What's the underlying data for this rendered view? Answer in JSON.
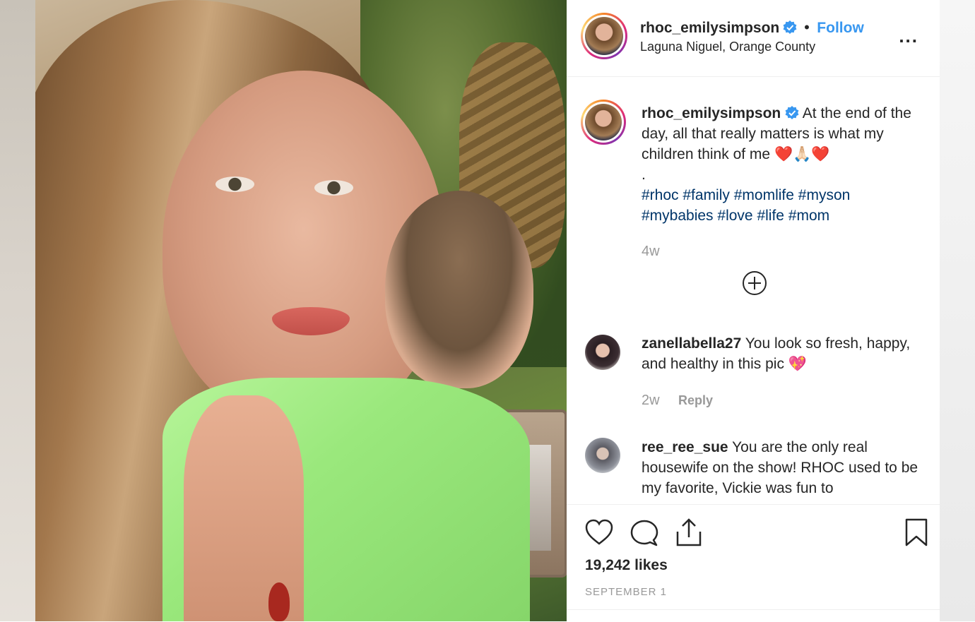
{
  "post": {
    "username": "rhoc_emilysimpson",
    "follow_label": "Follow",
    "separator": "•",
    "location": "Laguna Niguel, Orange County",
    "more_label": "..."
  },
  "caption": {
    "username": "rhoc_emilysimpson",
    "text": "At the end of the day, all that really matters is what my children think of me",
    "emoji": "❤️🙏🏻❤️",
    "dot": ".",
    "hashtags": [
      "#rhoc",
      "#family",
      "#momlife",
      "#myson",
      "#mybabies",
      "#love",
      "#life",
      "#mom"
    ],
    "age": "4w"
  },
  "comments": [
    {
      "username": "zanellabella27",
      "text": "You look so fresh, happy, and healthy in this pic",
      "emoji": "💖",
      "age": "2w",
      "reply_label": "Reply"
    },
    {
      "username": "ree_ree_sue",
      "text": "You are the only real housewife on the show! RHOC used to be my favorite, Vickie was fun to"
    }
  ],
  "actions": {
    "icons": [
      "heart-icon",
      "comment-icon",
      "share-icon",
      "bookmark-icon"
    ],
    "likes": "19,242 likes",
    "date": "SEPTEMBER 1"
  },
  "colors": {
    "link_blue": "#3897f0",
    "hashtag_blue": "#003569",
    "meta_gray": "#999999",
    "verified_blue": "#3897f0"
  }
}
